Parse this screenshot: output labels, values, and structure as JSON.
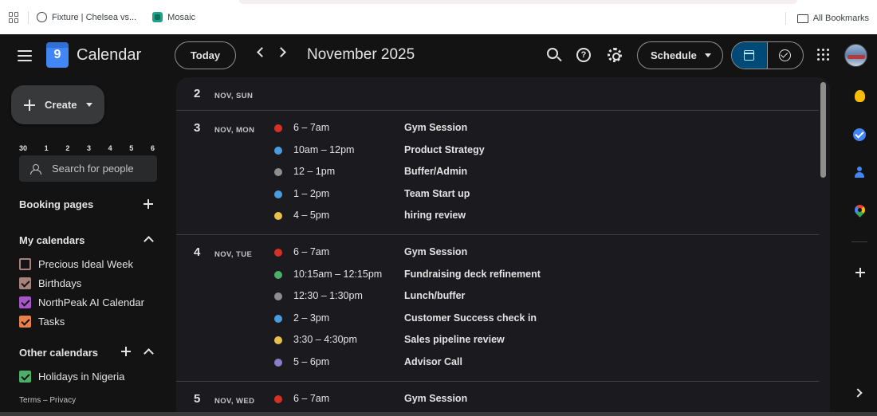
{
  "bookmarks": {
    "items": [
      {
        "label": "Fixture | Chelsea vs...",
        "icon": "globe-icon"
      },
      {
        "label": "Mosaic",
        "icon": "mosaic-icon"
      }
    ],
    "all_bookmarks": "All Bookmarks"
  },
  "header": {
    "app_title": "Calendar",
    "logo_day": "9",
    "today": "Today",
    "month": "November 2025",
    "view": "Schedule"
  },
  "sidebar": {
    "create": "Create",
    "mini_days": [
      "30",
      "1",
      "2",
      "3",
      "4",
      "5",
      "6"
    ],
    "search_people": "Search for people",
    "booking_pages": "Booking pages",
    "my_calendars": "My calendars",
    "calendars": [
      {
        "label": "Precious Ideal Week",
        "color": "#a8827a",
        "checked": false
      },
      {
        "label": "Birthdays",
        "color": "#a8827a",
        "checked": true
      },
      {
        "label": "NorthPeak AI Calendar",
        "color": "#a855c7",
        "checked": true
      },
      {
        "label": "Tasks",
        "color": "#e8804a",
        "checked": true
      }
    ],
    "other_calendars": "Other calendars",
    "other": [
      {
        "label": "Holidays in Nigeria",
        "color": "#4caf68",
        "checked": true
      }
    ],
    "footer": "Terms – Privacy"
  },
  "days": [
    {
      "num": "2",
      "label": "NOV, SUN",
      "events": []
    },
    {
      "num": "3",
      "label": "NOV, MON",
      "events": [
        {
          "time": "6 – 7am",
          "title": "Gym Session",
          "color": "#d93025"
        },
        {
          "time": "10am – 12pm",
          "title": "Product Strategy",
          "color": "#4a9ce0"
        },
        {
          "time": "12 – 1pm",
          "title": "Buffer/Admin",
          "color": "#8e8e8e"
        },
        {
          "time": "1 – 2pm",
          "title": "Team Start up",
          "color": "#4a9ce0"
        },
        {
          "time": "4 – 5pm",
          "title": "hiring review",
          "color": "#e8c04a"
        }
      ]
    },
    {
      "num": "4",
      "label": "NOV, TUE",
      "events": [
        {
          "time": "6 – 7am",
          "title": "Gym Session",
          "color": "#d93025"
        },
        {
          "time": "10:15am – 12:15pm",
          "title": "Fundraising deck refinement",
          "color": "#4caf68"
        },
        {
          "time": "12:30 – 1:30pm",
          "title": "Lunch/buffer",
          "color": "#8e8e8e"
        },
        {
          "time": "2 – 3pm",
          "title": "Customer Success check in",
          "color": "#4a9ce0"
        },
        {
          "time": "3:30 – 4:30pm",
          "title": "Sales pipeline review",
          "color": "#e8c04a"
        },
        {
          "time": "5 – 6pm",
          "title": "Advisor Call",
          "color": "#8a7cc9"
        }
      ]
    },
    {
      "num": "5",
      "label": "NOV, WED",
      "events": [
        {
          "time": "6 – 7am",
          "title": "Gym Session",
          "color": "#d93025"
        }
      ]
    }
  ]
}
